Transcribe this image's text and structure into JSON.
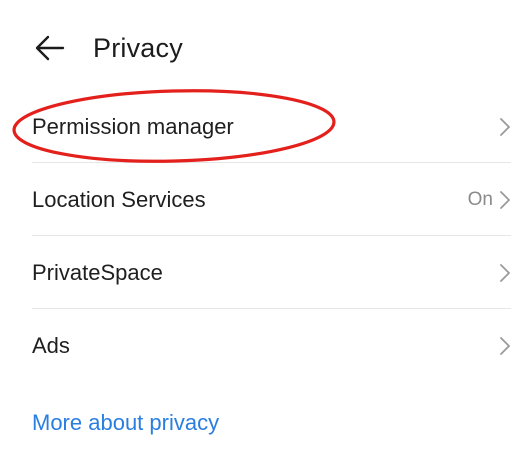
{
  "header": {
    "title": "Privacy",
    "back_icon": "arrow-left-icon"
  },
  "rows": [
    {
      "label": "Permission manager",
      "value": "",
      "icon": "chevron-right-icon"
    },
    {
      "label": "Location Services",
      "value": "On",
      "icon": "chevron-right-icon"
    },
    {
      "label": "PrivateSpace",
      "value": "",
      "icon": "chevron-right-icon"
    },
    {
      "label": "Ads",
      "value": "",
      "icon": "chevron-right-icon"
    }
  ],
  "footer": {
    "link_label": "More about privacy"
  },
  "colors": {
    "accent": "#2a7ee0",
    "highlight": "#e3201b",
    "text": "#1f1f1f",
    "secondary": "#8a8a8a",
    "divider": "#e6e6e6"
  }
}
